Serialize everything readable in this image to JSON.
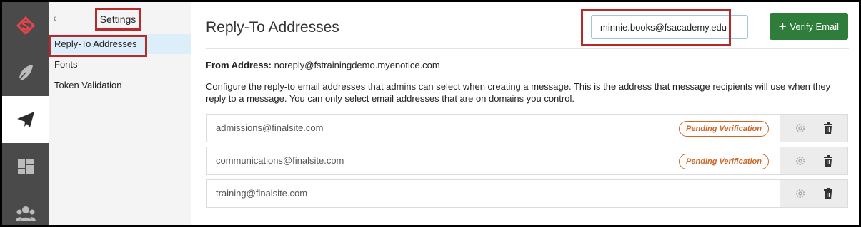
{
  "subnav": {
    "back_icon": "chevron-left-icon",
    "title": "Settings",
    "items": [
      {
        "label": "Reply-To Addresses"
      },
      {
        "label": "Fonts"
      },
      {
        "label": "Token Validation"
      }
    ]
  },
  "rail": {
    "icons": [
      "finalsite-logo-icon",
      "feather-icon",
      "paper-plane-icon",
      "dashboard-icon",
      "users-icon"
    ],
    "active": "paper-plane-icon"
  },
  "main": {
    "title": "Reply-To Addresses",
    "email_input_value": "minnie.books@fsacademy.edu",
    "verify_button_label": "Verify Email",
    "from_label": "From Address:",
    "from_value": "noreply@fstrainingdemo.myenotice.com",
    "description": "Configure the reply-to email addresses that admins can select when creating a message. This is the address that message recipients will use when they reply to a message. You can only select email addresses that are on domains you control.",
    "addresses": [
      {
        "email": "admissions@finalsite.com",
        "badge": "Pending Verification"
      },
      {
        "email": "communications@finalsite.com",
        "badge": "Pending Verification"
      },
      {
        "email": "training@finalsite.com",
        "badge": ""
      }
    ]
  },
  "colors": {
    "accent_green": "#2f7d3a",
    "pending_orange": "#c9692a",
    "annotation_red": "#b52b2b",
    "rail_bg": "#4a4a4a"
  }
}
